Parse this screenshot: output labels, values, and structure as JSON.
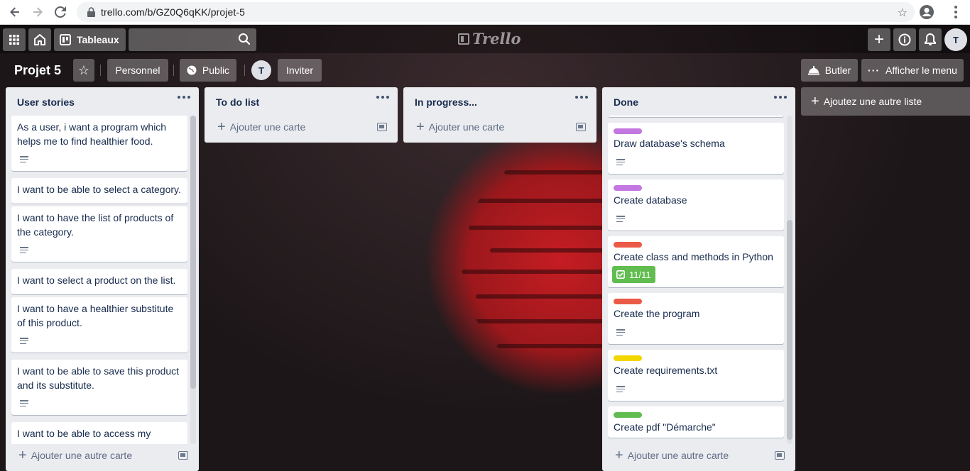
{
  "browser": {
    "url": "trello.com/b/GZ0Q6qKK/projet-5"
  },
  "header": {
    "boards_label": "Tableaux",
    "search_placeholder": "",
    "logo_text": "Trello",
    "avatar_initial": "T"
  },
  "board": {
    "title": "Projet 5",
    "visibility_team": "Personnel",
    "visibility": "Public",
    "member_initial": "T",
    "invite_label": "Inviter",
    "butler_label": "Butler",
    "menu_label": "Afficher le menu"
  },
  "lists": [
    {
      "title": "User stories",
      "cards": [
        {
          "text": "As a user, i want a program which helps me to find healthier food.",
          "has_description": true
        },
        {
          "text": "I want to be able to select a category.",
          "has_description": false
        },
        {
          "text": "I want to have the list of products of the category.",
          "has_description": true
        },
        {
          "text": "I want to select a product on the list.",
          "has_description": false
        },
        {
          "text": "I want to have a healthier substitute of this product.",
          "has_description": true
        },
        {
          "text": "I want to be able to save this product and its substitute.",
          "has_description": true
        },
        {
          "text": "I want to be able to access my",
          "has_description": false
        }
      ],
      "add_card_label": "Ajouter une autre carte"
    },
    {
      "title": "To do list",
      "cards": [],
      "add_card_label": "Ajouter une carte"
    },
    {
      "title": "In progress...",
      "cards": [],
      "add_card_label": "Ajouter une carte"
    },
    {
      "title": "Done",
      "cards": [
        {
          "text": "Draw database's schema",
          "label_color": "#c377e0",
          "has_description": true
        },
        {
          "text": "Create database",
          "label_color": "#c377e0",
          "has_description": true
        },
        {
          "text": "Create class and methods in Python",
          "label_color": "#eb5a46",
          "checklist": "11/11"
        },
        {
          "text": "Create the program",
          "label_color": "#eb5a46",
          "has_description": true
        },
        {
          "text": "Create requirements.txt",
          "label_color": "#f2d600",
          "has_description": true
        },
        {
          "text": "Create pdf \"Démarche\"",
          "label_color": "#61bd4f",
          "has_description": false
        }
      ],
      "add_card_label": "Ajouter une autre carte"
    }
  ],
  "add_list_label": "Ajoutez une autre liste"
}
